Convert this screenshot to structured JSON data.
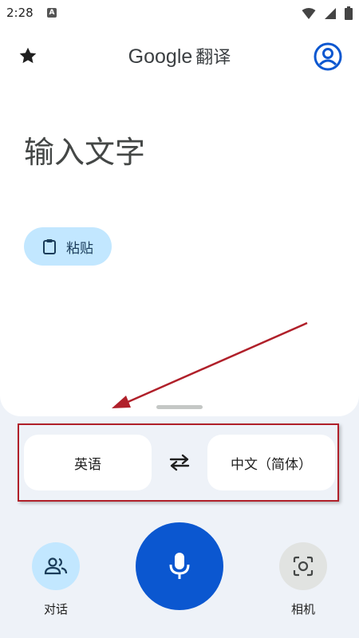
{
  "status_bar": {
    "time": "2:28",
    "app_icon_letter": "A"
  },
  "header": {
    "title_brand": "Google",
    "title_suffix": "翻译"
  },
  "input": {
    "placeholder": "输入文字"
  },
  "paste": {
    "label": "粘贴"
  },
  "languages": {
    "source": "英语",
    "target": "中文（简体）"
  },
  "actions": {
    "conversation_label": "对话",
    "camera_label": "相机"
  },
  "colors": {
    "accent": "#0b57d0",
    "chip": "#c2e7ff",
    "annotation": "#b0202a"
  }
}
